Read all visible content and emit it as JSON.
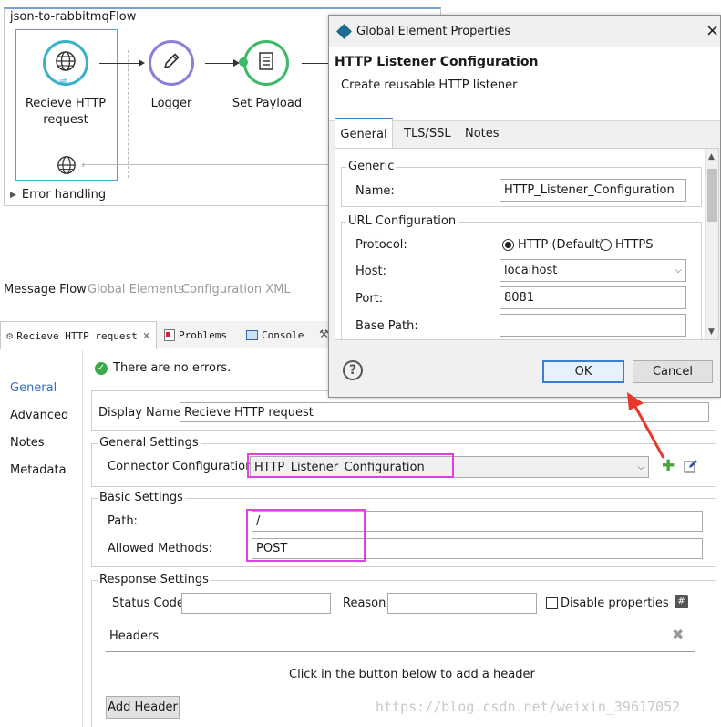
{
  "flow": {
    "title": "json-to-rabbitmqFlow",
    "nodes": [
      {
        "label": "Recieve HTTP\nrequest",
        "icon": "globe-icon"
      },
      {
        "label": "Logger",
        "icon": "pencil-icon"
      },
      {
        "label": "Set Payload",
        "icon": "document-list-icon"
      }
    ],
    "error_handling": "Error handling",
    "colors": {
      "http": "#3bb0c9",
      "logger": "#8a7fd6",
      "payload": "#3cba6a"
    }
  },
  "view_tabs": [
    "Message Flow",
    "Global Elements",
    "Configuration XML"
  ],
  "editor_tabs": [
    {
      "label": "Recieve HTTP request",
      "icon": "gear-icon",
      "close": "×"
    },
    {
      "label": "Problems",
      "icon": "problems-icon"
    },
    {
      "label": "Console",
      "icon": "console-icon"
    }
  ],
  "side_nav": [
    "General",
    "Advanced",
    "Notes",
    "Metadata"
  ],
  "status": {
    "text": "There are no errors."
  },
  "general": {
    "display_name_label": "Display Name:",
    "display_name": "Recieve HTTP request",
    "general_settings_title": "General Settings",
    "connector_label": "Connector Configuration:",
    "connector_value": "HTTP_Listener_Configuration",
    "basic_settings_title": "Basic Settings",
    "path_label": "Path:",
    "path_value": "/",
    "methods_label": "Allowed Methods:",
    "methods_value": "POST",
    "response_settings_title": "Response Settings",
    "status_code_label": "Status Code:",
    "reason_label": "Reason:",
    "disable_properties": "Disable properties",
    "headers_label": "Headers",
    "headers_hint": "Click in the button below to add a header",
    "add_header": "Add Header"
  },
  "dialog": {
    "window_title": "Global Element Properties",
    "heading": "HTTP Listener Configuration",
    "subheading": "Create reusable HTTP listener",
    "tabs": [
      "General",
      "TLS/SSL",
      "Notes"
    ],
    "generic_title": "Generic",
    "name_label": "Name:",
    "name_value": "HTTP_Listener_Configuration",
    "url_title": "URL Configuration",
    "protocol_label": "Protocol:",
    "protocol_http": "HTTP (Default)",
    "protocol_https": "HTTPS",
    "host_label": "Host:",
    "host_value": "localhost",
    "port_label": "Port:",
    "port_value": "8081",
    "base_path_label": "Base Path:",
    "ok": "OK",
    "cancel": "Cancel",
    "close": "×",
    "help": "?"
  },
  "watermark": "https://blog.csdn.net/weixin_39617052"
}
